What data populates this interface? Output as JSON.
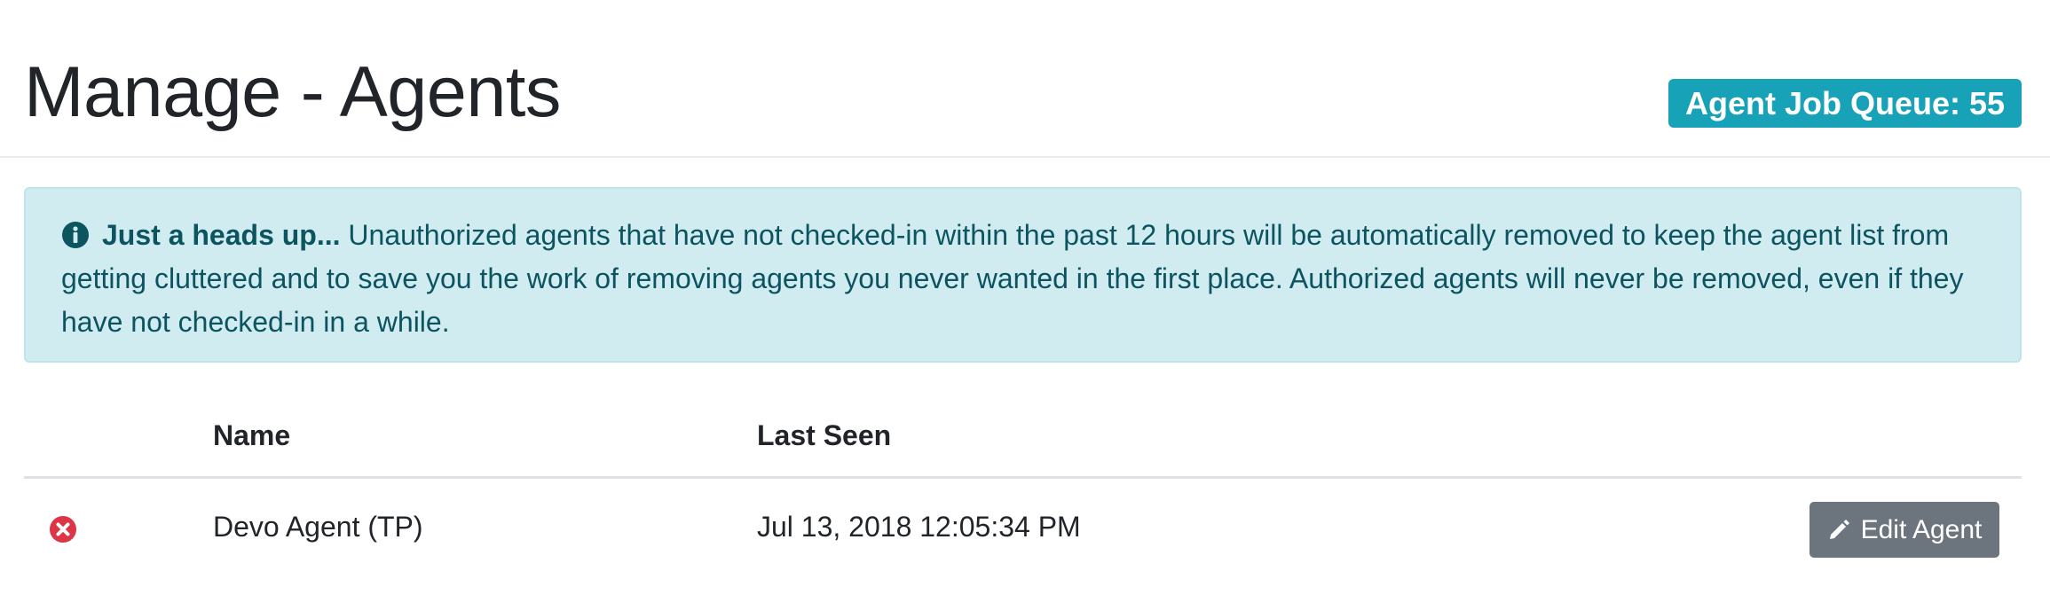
{
  "header": {
    "title": "Manage - Agents",
    "queue_badge": "Agent Job Queue: 55"
  },
  "alert": {
    "icon": "info-circle-icon",
    "strong": "Just a heads up...",
    "text": " Unauthorized agents that have not checked-in within the past 12 hours will be automatically removed to keep the agent list from getting cluttered and to save you the work of removing agents you never wanted in the first place. Authorized agents will never be removed, even if they have not checked-in in a while."
  },
  "table": {
    "columns": [
      "",
      "Name",
      "Last Seen",
      ""
    ],
    "rows": [
      {
        "status_icon": "times-circle-icon",
        "status_color": "#dc3545",
        "name": "Devo Agent (TP)",
        "last_seen": "Jul 13, 2018 12:05:34 PM",
        "action_label": "Edit Agent",
        "action_icon": "pencil-icon"
      }
    ]
  },
  "colors": {
    "badge": "#17a2b8",
    "alert_bg": "#d1ecf1",
    "alert_text": "#0c5460",
    "danger": "#dc3545",
    "secondary_button": "#6c757d"
  }
}
